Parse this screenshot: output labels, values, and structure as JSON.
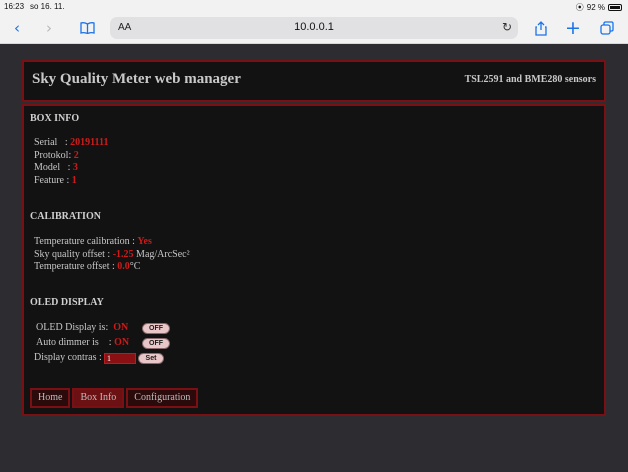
{
  "status": {
    "time": "16:23",
    "date": "so 16. 11.",
    "battery": "92 %"
  },
  "browser": {
    "aa": "AA",
    "url": "10.0.0.1"
  },
  "header": {
    "title": "Sky Quality Meter web manager",
    "subtitle": "TSL2591 and BME280 sensors"
  },
  "box_info": {
    "title": "BOX INFO",
    "rows": [
      {
        "label": "Serial   : ",
        "value": "20191111"
      },
      {
        "label": "Protokol: ",
        "value": "2"
      },
      {
        "label": "Model   : ",
        "value": "3"
      },
      {
        "label": "Feature : ",
        "value": "1"
      }
    ]
  },
  "calibration": {
    "title": "CALIBRATION",
    "temp_label": "Temperature calibration : ",
    "temp_value": "Yes",
    "sky_label": "Sky quality offset : ",
    "sky_value": "-1.25",
    "sky_unit": " Mag/ArcSec²",
    "offset_label": "Temperature offset : ",
    "offset_value": "0.0",
    "offset_unit": "°C"
  },
  "oled": {
    "title": "OLED DISPLAY",
    "display_label": "OLED Display is:",
    "display_state": "ON",
    "display_button": "OFF",
    "dimmer_label": "Auto dimmer is    :",
    "dimmer_state": "ON",
    "dimmer_button": "OFF",
    "contrast_label": "Display contras : ",
    "contrast_value": "1",
    "set_label": "Set"
  },
  "nav": {
    "home": "Home",
    "box_info": "Box Info",
    "configuration": "Configuration"
  },
  "colors": {
    "accent": "#7a0f14",
    "value": "#d01a1a",
    "panel": "#121212",
    "background": "#2d2d31"
  }
}
